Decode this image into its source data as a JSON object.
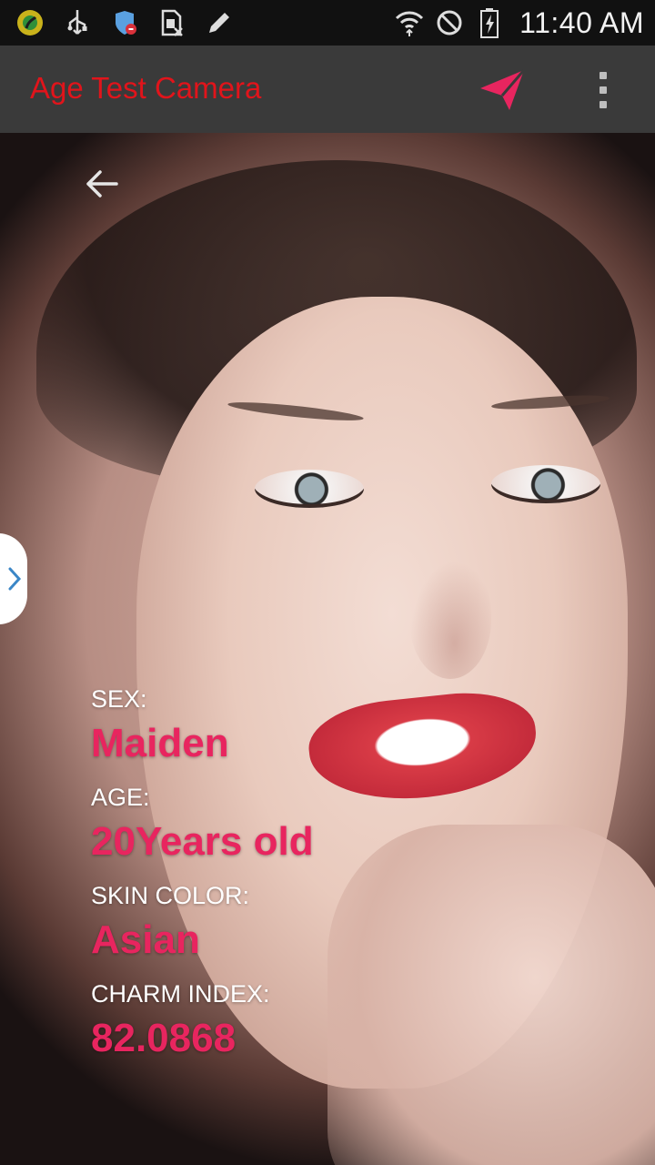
{
  "status_bar": {
    "time": "11:40 AM",
    "left_icons": [
      "app-notification-icon",
      "usb-icon",
      "security-shield-icon",
      "sim-card-icon",
      "edit-pencil-icon"
    ],
    "right_icons": [
      "wifi-icon",
      "do-not-disturb-icon",
      "battery-charging-icon"
    ]
  },
  "action_bar": {
    "title": "Age Test Camera",
    "title_color": "#e1141b",
    "actions": [
      "send-icon",
      "overflow-menu-icon"
    ]
  },
  "result": {
    "sex_label": "SEX:",
    "sex_value": "Maiden",
    "age_label": "AGE:",
    "age_value": "20Years old",
    "skin_label": "SKIN COLOR:",
    "skin_value": "Asian",
    "charm_label": "CHARM INDEX:",
    "charm_value": "82.0868",
    "value_color": "#e8255f"
  }
}
